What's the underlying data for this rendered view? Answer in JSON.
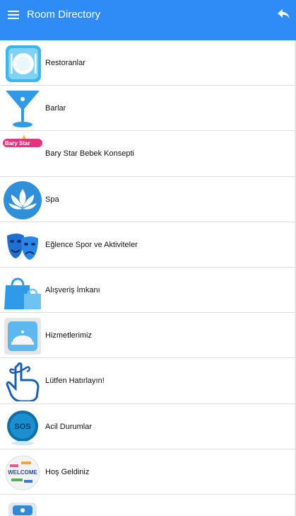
{
  "header": {
    "title": "Room Directory",
    "menu_icon": "menu-icon",
    "back_icon": "back-arrow-icon",
    "background_color": "#2f8bf5"
  },
  "items": [
    {
      "label": "Restoranlar",
      "icon": "restaurant-plate-icon"
    },
    {
      "label": "Barlar",
      "icon": "cocktail-glass-icon"
    },
    {
      "label": "Bary Star Bebek Konsepti",
      "icon": "bary-star-logo-icon"
    },
    {
      "label": "Spa",
      "icon": "lotus-icon"
    },
    {
      "label": "Eğlence Spor ve Aktiviteler",
      "icon": "theatre-masks-icon"
    },
    {
      "label": "Alışveriş İmkanı",
      "icon": "shopping-bags-icon"
    },
    {
      "label": "Hizmetlerimiz",
      "icon": "service-bell-icon"
    },
    {
      "label": "Lütfen Hatırlayın!",
      "icon": "finger-ribbon-icon"
    },
    {
      "label": "Acil Durumlar",
      "icon": "sos-icon"
    },
    {
      "label": "Hoş Geldiniz",
      "icon": "welcome-globe-icon"
    },
    {
      "label": "",
      "icon": "telephone-icon"
    }
  ],
  "logo_text": {
    "bary_star": "Bary Star",
    "sos": "SOS",
    "welcome": "WELCOME"
  }
}
